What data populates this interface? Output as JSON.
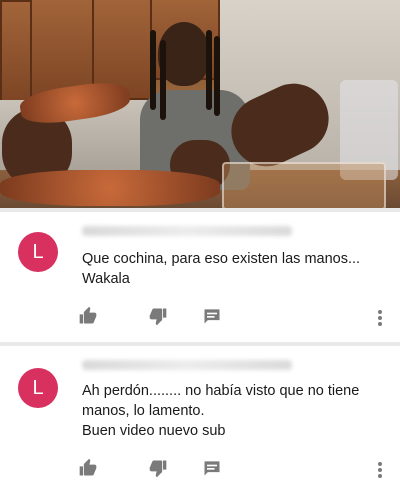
{
  "video": {
    "description_icon": "video-frame"
  },
  "comments": [
    {
      "avatar_letter": "L",
      "avatar_color": "#d8305f",
      "lines": [
        "Que cochina, para eso existen las manos...",
        "Wakala"
      ]
    },
    {
      "avatar_letter": "L",
      "avatar_color": "#d8305f",
      "lines": [
        "Ah perdón........ no había visto que no tiene",
        "manos, lo lamento.",
        "Buen video nuevo sub"
      ]
    }
  ],
  "icons": {
    "like": "thumbs-up-icon",
    "dislike": "thumbs-down-icon",
    "reply": "reply-icon",
    "more": "more-vert-icon"
  }
}
